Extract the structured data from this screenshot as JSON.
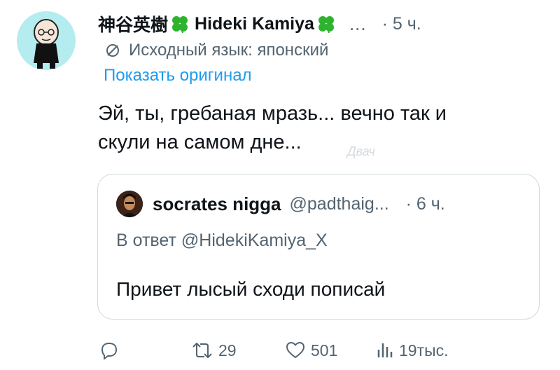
{
  "tweet": {
    "author_name_jp": "神谷英樹",
    "author_name_en": "Hideki Kamiya",
    "more": "...",
    "time": "· 5 ч.",
    "source_language": "Исходный язык: японский",
    "show_original": "Показать оригинал",
    "text_line1": "Эй, ты, гребаная мразь... вечно так и",
    "text_line2": "скули на самом дне...",
    "watermark": "Двач"
  },
  "quote": {
    "author_name": "socrates nigga",
    "handle": "@padthaig...",
    "time": "· 6 ч.",
    "reply_to": "В ответ @HidekiKamiya_X",
    "text": "Привет лысый сходи пописай"
  },
  "actions": {
    "replies": "",
    "retweets": "29",
    "likes": "501",
    "views": "19тыс."
  },
  "colors": {
    "secondary_text": "#536471",
    "link": "#1d9bf0",
    "border": "#cfd9de",
    "clover": "#2fb32f",
    "avatar_bg": "#b5ecf0"
  }
}
